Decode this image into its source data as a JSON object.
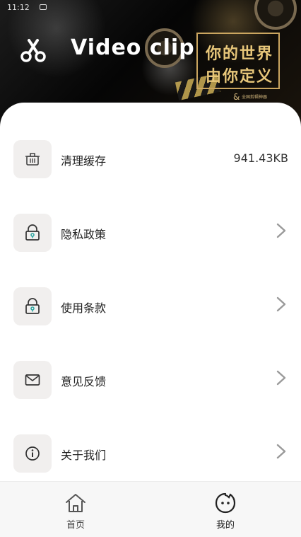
{
  "status_bar": {
    "time": "11:12"
  },
  "banner": {
    "title": "Video clip",
    "slogan_line1": "你的世界",
    "slogan_line2": "由你定义",
    "tiny_text": "全国剪辑神器"
  },
  "menu": {
    "items": [
      {
        "label": "清理缓存",
        "value": "941.43KB",
        "icon": "trash-icon"
      },
      {
        "label": "隐私政策",
        "icon": "lock-icon"
      },
      {
        "label": "使用条款",
        "icon": "lock-icon"
      },
      {
        "label": "意见反馈",
        "icon": "mail-icon"
      },
      {
        "label": "关于我们",
        "icon": "info-icon"
      }
    ]
  },
  "tabbar": {
    "tabs": [
      {
        "label": "首页",
        "icon": "home-icon"
      },
      {
        "label": "我的",
        "icon": "face-icon",
        "active": true
      }
    ]
  },
  "colors": {
    "icon_box_bg": "#f1efee",
    "chevron": "#9a9a9a",
    "slogan_gold": "#e8c77a",
    "tabbar_bg": "#f7f7f7"
  }
}
